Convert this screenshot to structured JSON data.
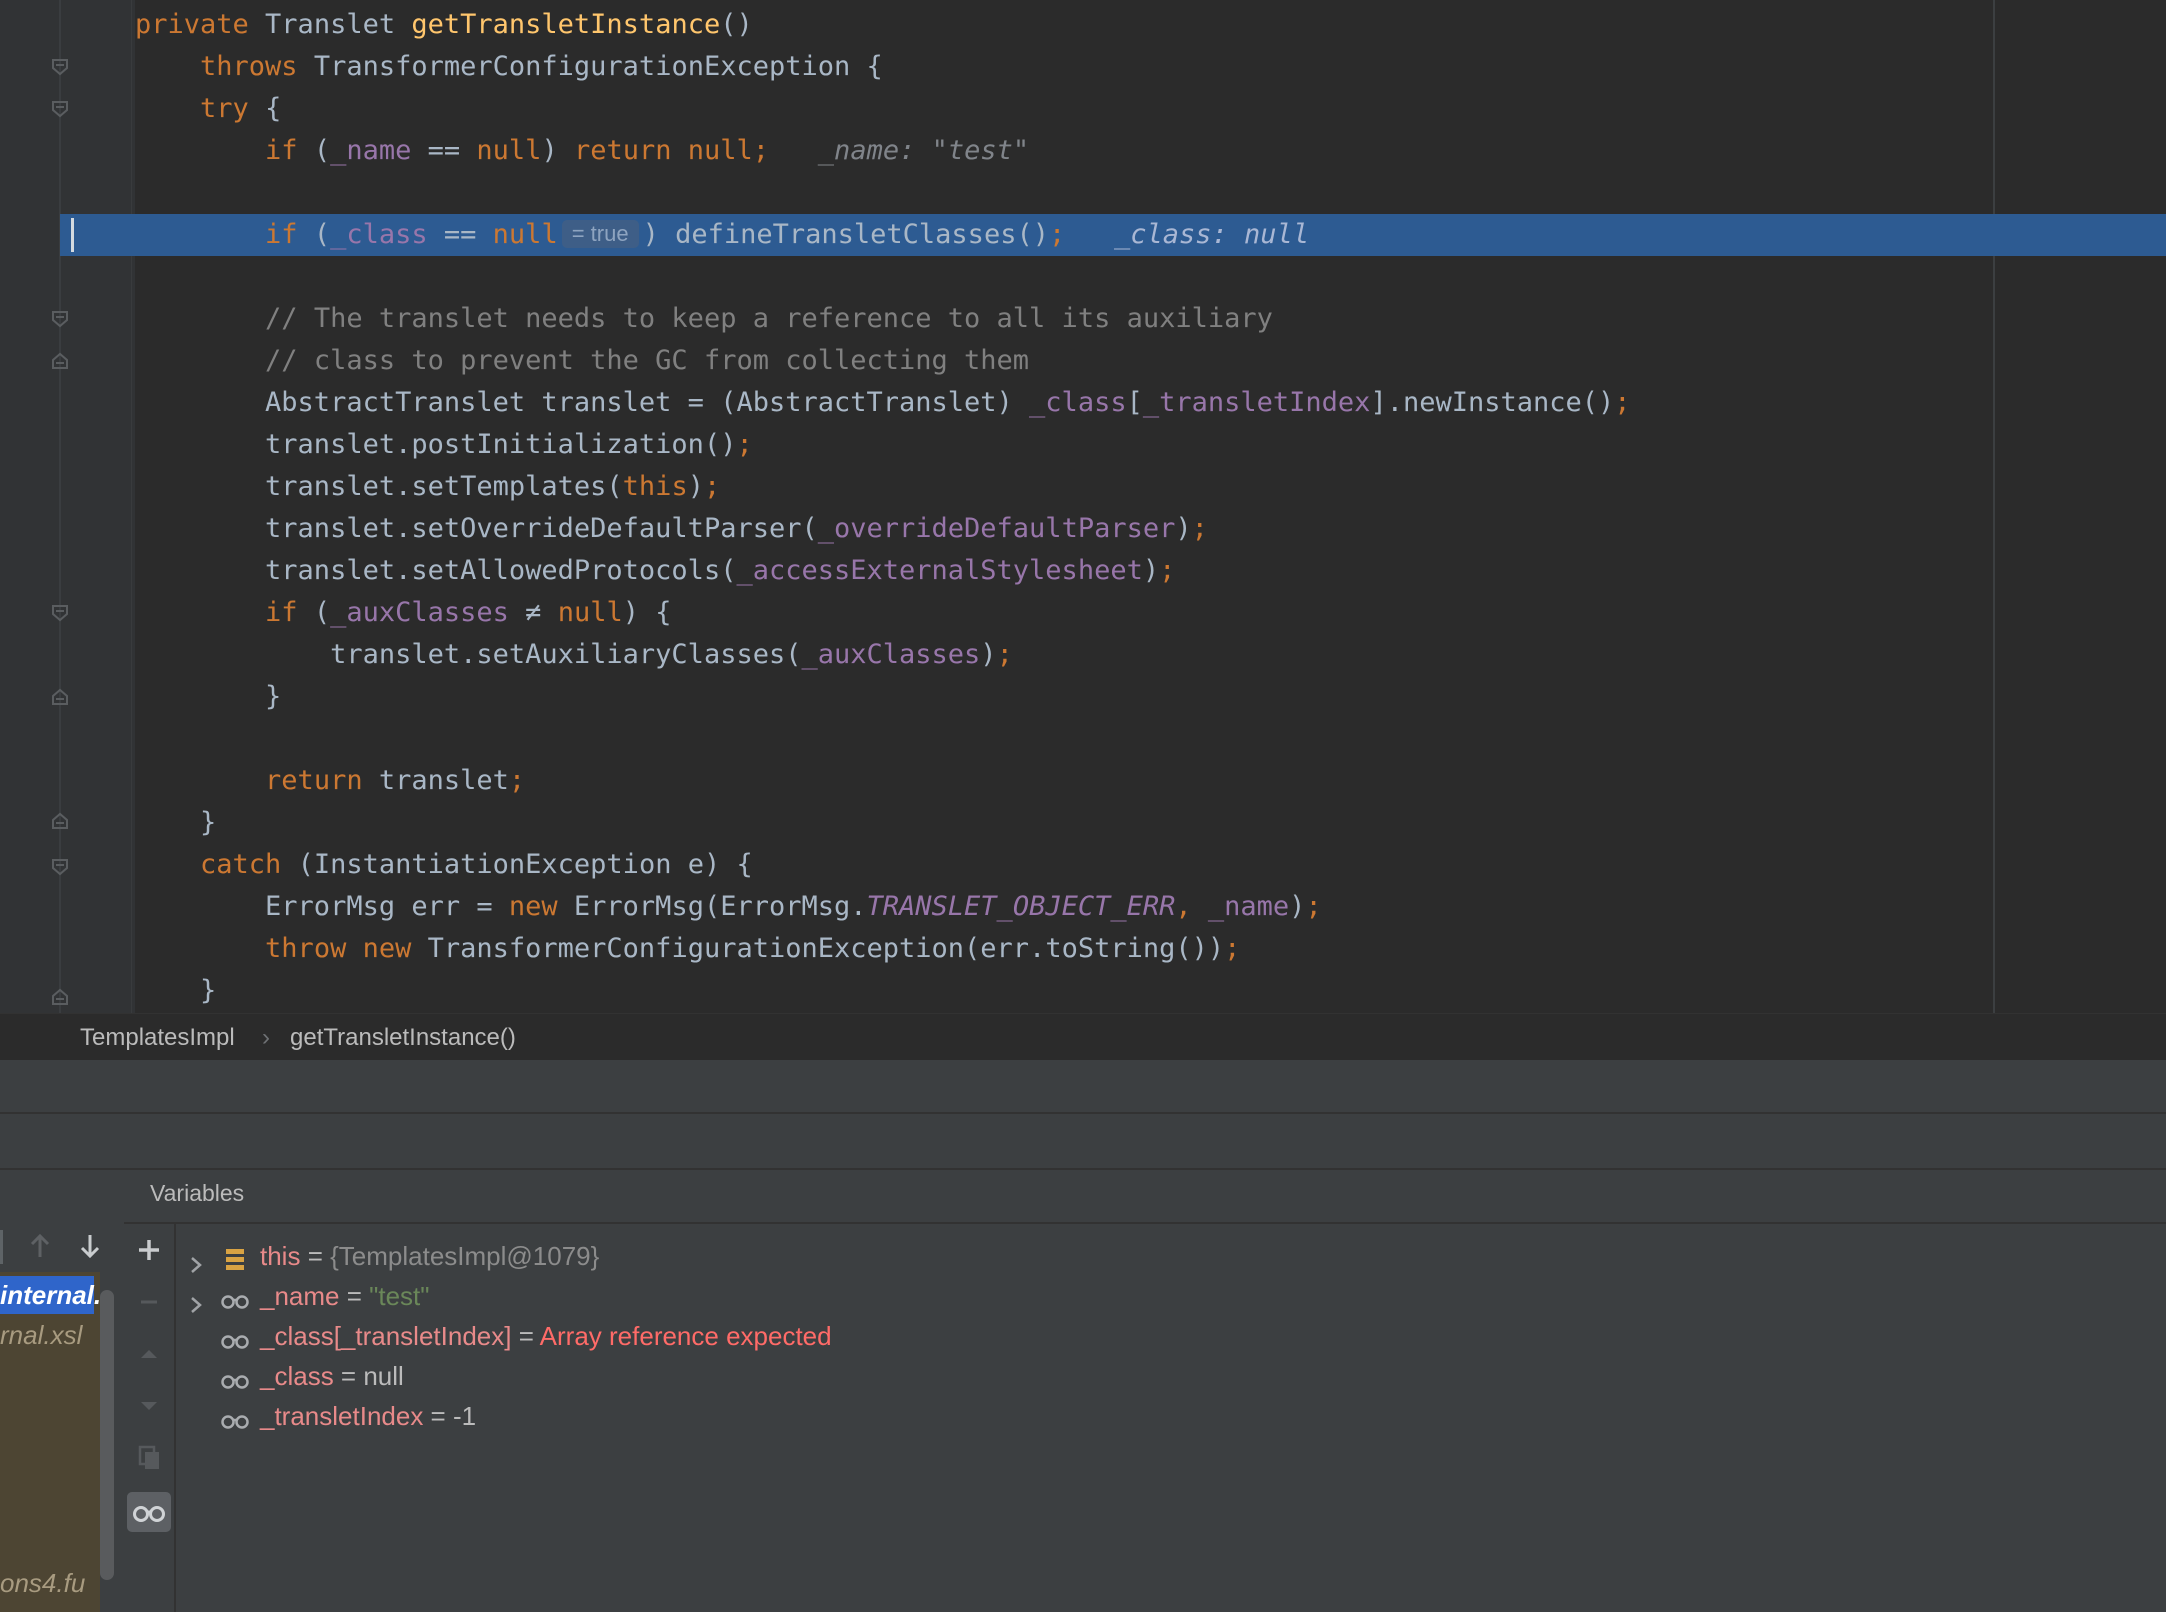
{
  "editor": {
    "lines": [
      {
        "tokens": [
          [
            "kw",
            "private "
          ],
          [
            "plain",
            "Translet "
          ],
          [
            "fn",
            "getTransletInstance"
          ],
          [
            "plain",
            "()"
          ]
        ]
      },
      {
        "tokens": [
          [
            "plain",
            "    "
          ],
          [
            "kw",
            "throws "
          ],
          [
            "plain",
            "TransformerConfigurationException {"
          ]
        ]
      },
      {
        "tokens": [
          [
            "plain",
            "    "
          ],
          [
            "kw",
            "try "
          ],
          [
            "plain",
            "{"
          ]
        ]
      },
      {
        "tokens": [
          [
            "plain",
            "        "
          ],
          [
            "kw",
            "if "
          ],
          [
            "plain",
            "("
          ],
          [
            "fld",
            "_name"
          ],
          [
            "plain",
            " == "
          ],
          [
            "kw",
            "null"
          ],
          [
            "plain",
            ") "
          ],
          [
            "kw",
            "return null"
          ],
          [
            "kw",
            ";"
          ],
          [
            "plain",
            "  "
          ],
          [
            "hint",
            " _name: \"test\""
          ]
        ]
      },
      {
        "tokens": []
      },
      {
        "tokens": [
          [
            "plain",
            "        "
          ],
          [
            "kw",
            "if "
          ],
          [
            "plain",
            "("
          ],
          [
            "fld",
            "_class"
          ],
          [
            "plain",
            " == "
          ],
          [
            "kw",
            "null"
          ],
          [
            "inlay",
            "= true"
          ],
          [
            "plain",
            ") defineTransletClasses()"
          ],
          [
            "kw",
            ";"
          ],
          [
            "plain",
            "  "
          ],
          [
            "hint-hl",
            " _class: null"
          ]
        ]
      },
      {
        "tokens": []
      },
      {
        "tokens": [
          [
            "plain",
            "        "
          ],
          [
            "cmt",
            "// The translet needs to keep a reference to all its auxiliary"
          ]
        ]
      },
      {
        "tokens": [
          [
            "plain",
            "        "
          ],
          [
            "cmt",
            "// class to prevent the GC from collecting them"
          ]
        ]
      },
      {
        "tokens": [
          [
            "plain",
            "        AbstractTranslet translet = (AbstractTranslet) "
          ],
          [
            "fld",
            "_class"
          ],
          [
            "plain",
            "["
          ],
          [
            "fld",
            "_transletIndex"
          ],
          [
            "plain",
            "].newInstance()"
          ],
          [
            "kw",
            ";"
          ]
        ]
      },
      {
        "tokens": [
          [
            "plain",
            "        translet.postInitialization()"
          ],
          [
            "kw",
            ";"
          ]
        ]
      },
      {
        "tokens": [
          [
            "plain",
            "        translet.setTemplates("
          ],
          [
            "kw",
            "this"
          ],
          [
            "plain",
            ")"
          ],
          [
            "kw",
            ";"
          ]
        ]
      },
      {
        "tokens": [
          [
            "plain",
            "        translet.setOverrideDefaultParser("
          ],
          [
            "fld",
            "_overrideDefaultParser"
          ],
          [
            "plain",
            ")"
          ],
          [
            "kw",
            ";"
          ]
        ]
      },
      {
        "tokens": [
          [
            "plain",
            "        translet.setAllowedProtocols("
          ],
          [
            "fld",
            "_accessExternalStylesheet"
          ],
          [
            "plain",
            ")"
          ],
          [
            "kw",
            ";"
          ]
        ]
      },
      {
        "tokens": [
          [
            "plain",
            "        "
          ],
          [
            "kw",
            "if "
          ],
          [
            "plain",
            "("
          ],
          [
            "fld",
            "_auxClasses"
          ],
          [
            "plain",
            " ≠ "
          ],
          [
            "kw",
            "null"
          ],
          [
            "plain",
            ") {"
          ]
        ]
      },
      {
        "tokens": [
          [
            "plain",
            "            translet.setAuxiliaryClasses("
          ],
          [
            "fld",
            "_auxClasses"
          ],
          [
            "plain",
            ")"
          ],
          [
            "kw",
            ";"
          ]
        ]
      },
      {
        "tokens": [
          [
            "plain",
            "        }"
          ]
        ]
      },
      {
        "tokens": []
      },
      {
        "tokens": [
          [
            "plain",
            "        "
          ],
          [
            "kw",
            "return "
          ],
          [
            "plain",
            "translet"
          ],
          [
            "kw",
            ";"
          ]
        ]
      },
      {
        "tokens": [
          [
            "plain",
            "    }"
          ]
        ]
      },
      {
        "tokens": [
          [
            "plain",
            "    "
          ],
          [
            "kw",
            "catch "
          ],
          [
            "plain",
            "(InstantiationException e) {"
          ]
        ]
      },
      {
        "tokens": [
          [
            "plain",
            "        ErrorMsg err = "
          ],
          [
            "kw",
            "new "
          ],
          [
            "plain",
            "ErrorMsg(ErrorMsg."
          ],
          [
            "cnst",
            "TRANSLET_OBJECT_ERR"
          ],
          [
            "kw",
            ", "
          ],
          [
            "fld",
            "_name"
          ],
          [
            "plain",
            ")"
          ],
          [
            "kw",
            ";"
          ]
        ]
      },
      {
        "tokens": [
          [
            "plain",
            "        "
          ],
          [
            "kw",
            "throw new "
          ],
          [
            "plain",
            "TransformerConfigurationException(err.toString())"
          ],
          [
            "kw",
            ";"
          ]
        ]
      },
      {
        "tokens": [
          [
            "plain",
            "    }"
          ]
        ]
      }
    ]
  },
  "breadcrumb": {
    "class_name": "TemplatesImpl",
    "separator": "›",
    "method_name": "getTransletInstance()"
  },
  "frames": {
    "items": [
      "internal.",
      "rnal.xsl",
      "ons4.fu"
    ]
  },
  "variables": {
    "title": "Variables",
    "rows": [
      {
        "name": "this",
        "eq": " = ",
        "value": "{TemplatesImpl@1079}",
        "value_type": "obj",
        "icon": "field-icon",
        "expandable": true
      },
      {
        "name": "_name",
        "eq": " = ",
        "value": "\"test\"",
        "value_type": "str",
        "icon": "watch-icon",
        "expandable": true
      },
      {
        "name": "_class[_transletIndex]",
        "eq": " = ",
        "value": "Array reference expected",
        "value_type": "err",
        "icon": "watch-icon",
        "expandable": false
      },
      {
        "name": "_class",
        "eq": " = ",
        "value": "null",
        "value_type": "plain",
        "icon": "watch-icon",
        "expandable": false
      },
      {
        "name": "_transletIndex",
        "eq": " = ",
        "value": "-1",
        "value_type": "plain",
        "icon": "watch-icon",
        "expandable": false
      }
    ]
  }
}
